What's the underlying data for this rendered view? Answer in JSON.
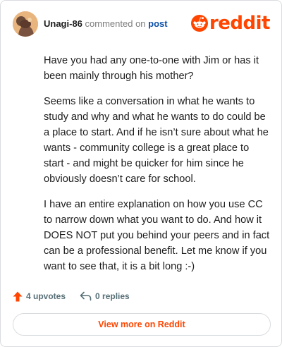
{
  "comment": {
    "username": "Unagi-86",
    "action_text": "commented on",
    "post_link_text": "post",
    "paragraphs": [
      "Have you had any one-to-one with Jim or has it been mainly through his mother?",
      "Seems like a conversation in what he wants to study and why and what he wants to do could be a place to start. And if he isn’t sure about what he wants - community college is a great place to start - and might be quicker for him since he obviously doesn’t care for school.",
      "I have an entire explanation on how you use CC to narrow down what you want to do. And how it DOES NOT put you behind your peers and in fact can be a professional benefit. Let me know if you want to see that, it is a bit long :-)"
    ],
    "upvotes_text": "4 upvotes",
    "replies_text": "0 replies"
  },
  "brand": {
    "logo_text": "reddit",
    "accent_color": "#ff4500"
  },
  "actions": {
    "view_more_label": "View more on Reddit"
  },
  "icons": {
    "avatar": "snoo-avatar",
    "logo": "reddit-snoo-icon",
    "upvote": "upvote-arrow-icon",
    "reply": "reply-arrow-icon"
  }
}
